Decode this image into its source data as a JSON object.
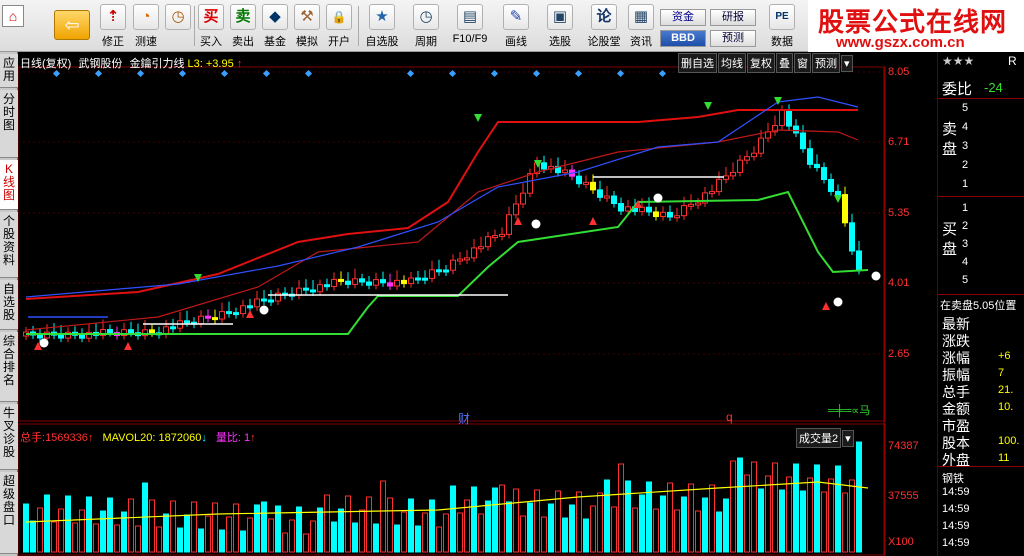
{
  "app": {
    "logo_char": "⌂",
    "back_arrow": "⇦"
  },
  "toolbar": {
    "buttons": [
      {
        "label": "修正",
        "icon": "⇡"
      },
      {
        "label": "测速",
        "icon": "◔"
      },
      {
        "label": "买入",
        "icon": "买"
      },
      {
        "label": "卖出",
        "icon": "卖"
      },
      {
        "label": "基金",
        "icon": "◆"
      },
      {
        "label": "模拟",
        "icon": "⚒"
      },
      {
        "label": "开户",
        "icon": "🔒"
      },
      {
        "label": "自选股",
        "icon": "★"
      },
      {
        "label": "周期",
        "icon": "◷"
      },
      {
        "label": "F10/F9",
        "icon": "▤"
      },
      {
        "label": "画线",
        "icon": "✎"
      },
      {
        "label": "选股",
        "icon": "▣"
      },
      {
        "label": "论股堂",
        "icon": "论"
      },
      {
        "label": "资讯",
        "icon": "▦"
      }
    ],
    "small_buttons": [
      "资金",
      "BBD",
      "研报",
      "预测"
    ],
    "data_button": {
      "label": "数据",
      "icon": "PE"
    }
  },
  "watermark": {
    "line1": "股票公式在线网",
    "line2": "www.gszx.com.cn"
  },
  "left_tabs": [
    "应用",
    "分时图",
    "K线图",
    "个股资料",
    "自选股",
    "综合排名",
    "牛叉诊股",
    "超级盘口"
  ],
  "chart": {
    "period": "日线(复权)",
    "stock_name": "武钢股份",
    "indicator": "金鑰引力线",
    "l3_label": "L3:",
    "l3_value": "+3.95",
    "tabs": [
      "删自选",
      "均线",
      "复权",
      "叠",
      "窗",
      "预测"
    ],
    "price_axis": [
      "8.05",
      "6.71",
      "5.35",
      "4.01",
      "2.65"
    ],
    "volume_axis": [
      "74387",
      "37555",
      "X100"
    ],
    "volume_info": {
      "total_label": "总手:",
      "total_value": "1569336",
      "mavol_label": "MAVOL20:",
      "mavol_value": "1872060",
      "ratio_label": "量比:",
      "ratio_value": "1"
    },
    "volume_tab": "成交量2",
    "event_labels": [
      "财",
      "q"
    ],
    "legend_symbol": "═╪═∝马",
    "colors": {
      "up": "#ff3030",
      "down": "#00ffff",
      "yellow": "#ffff00",
      "green_line": "#33dd33",
      "red_line": "#e01010",
      "blue_line": "#3050ff",
      "magenta": "#ff30ff"
    }
  },
  "right_panel": {
    "stars": "★★★",
    "code_prefix": "R",
    "wei_bi_label": "委比",
    "wei_bi_value": "-24",
    "sell_label": "卖盘",
    "sell_levels": [
      "5",
      "4",
      "3",
      "2",
      "1"
    ],
    "buy_label": "买盘",
    "buy_levels": [
      "1",
      "2",
      "3",
      "4",
      "5"
    ],
    "position_text": "在卖盘5.05位置",
    "stats": [
      {
        "label": "最新",
        "value": ""
      },
      {
        "label": "涨跌",
        "value": ""
      },
      {
        "label": "涨幅",
        "value": "+6"
      },
      {
        "label": "振幅",
        "value": "7"
      },
      {
        "label": "总手",
        "value": "21."
      },
      {
        "label": "金额",
        "value": "10."
      },
      {
        "label": "市盈",
        "value": ""
      },
      {
        "label": "股本",
        "value": "100."
      },
      {
        "label": "外盘",
        "value": "11"
      }
    ],
    "industry": "钢铁",
    "times": [
      "14:59",
      "14:59",
      "14:59",
      "14:59"
    ]
  }
}
